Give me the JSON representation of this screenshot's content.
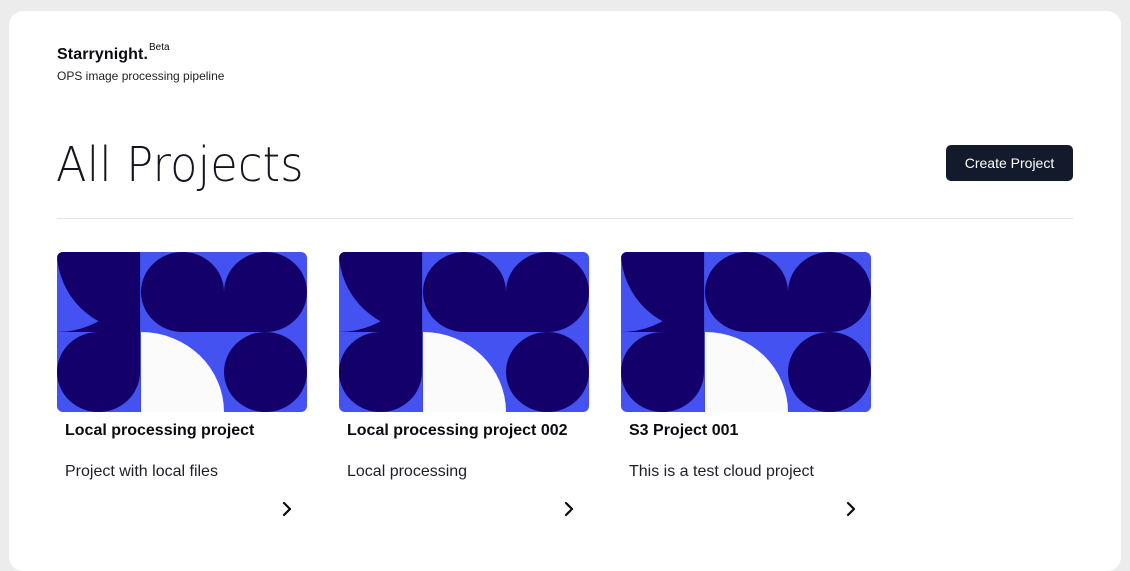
{
  "brand": {
    "name": "Starrynight.",
    "badge": "Beta",
    "tagline": "OPS image processing pipeline"
  },
  "page": {
    "title": "All Projects",
    "create_button_label": "Create Project"
  },
  "colors": {
    "art_light": "#4452f2",
    "art_dark": "#14006b",
    "art_white": "#fbfbfb",
    "button_bg": "#121a2c"
  },
  "projects": [
    {
      "title": "Local processing project",
      "description": "Project with local files",
      "thumbnail_icon": "geometric-pattern-image",
      "open_icon": "chevron-right-icon"
    },
    {
      "title": "Local processing project 002",
      "description": "Local processing",
      "thumbnail_icon": "geometric-pattern-image",
      "open_icon": "chevron-right-icon"
    },
    {
      "title": "S3 Project 001",
      "description": "This is a test cloud project",
      "thumbnail_icon": "geometric-pattern-image",
      "open_icon": "chevron-right-icon"
    }
  ]
}
